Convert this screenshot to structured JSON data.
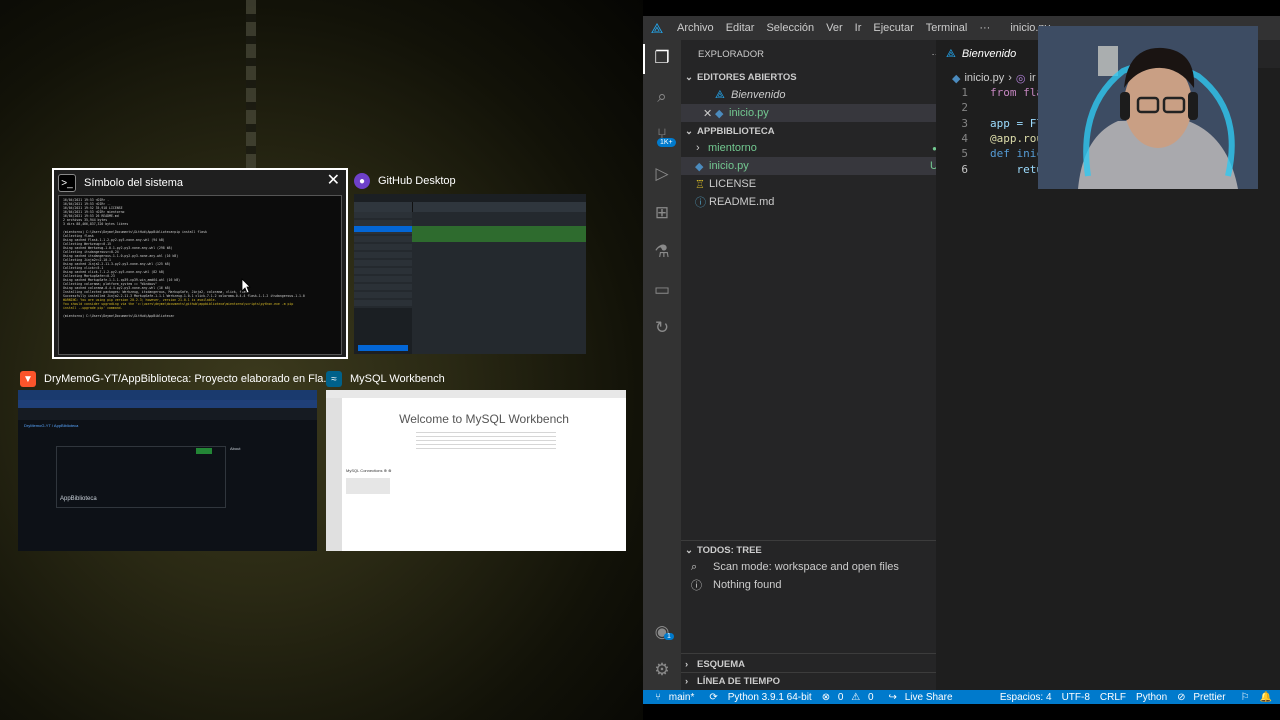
{
  "task_switcher": {
    "windows": [
      {
        "title": "Símbolo del sistema",
        "icon": "terminal-icon",
        "selected": true
      },
      {
        "title": "GitHub Desktop",
        "icon": "github-icon"
      },
      {
        "title": "DryMemoG-YT/AppBiblioteca: Proyecto elaborado en Fla...",
        "icon": "brave-browser-icon"
      },
      {
        "title": "MySQL Workbench",
        "icon": "mysql-workbench-icon"
      }
    ],
    "terminal_lines": [
      "16/04/2021  19:53    <DIR>          .",
      "16/04/2021  19:53    <DIR>          ..",
      "16/04/2021  19:52            35,918 LICENSE",
      "16/04/2021  19:53    <DIR>          mientorno",
      "16/04/2021  19:53                 26 README.md",
      "               2 archivos         35,944 bytes",
      "               3 dirs  88,466,837,320 bytes libres",
      "",
      "(mientorno) C:\\Users\\Deyme\\Documents\\GitHub\\AppBiblioteca>pip install flask",
      "Collecting flask",
      "  Using cached Flask-1.1.2-py2.py3-none-any.whl (94 kB)",
      "Collecting Werkzeug>=0.15",
      "  Using cached Werkzeug-1.0.1-py2.py3-none-any.whl (298 kB)",
      "Collecting itsdangerous>=0.24",
      "  Using cached itsdangerous-1.1.0-py2.py3-none-any.whl (16 kB)",
      "Collecting Jinja2>=2.10.1",
      "  Using cached Jinja2-2.11.3-py2.py3-none-any.whl (125 kB)",
      "Collecting click>=5.1",
      "  Using cached click-7.1.2-py2.py3-none-any.whl (82 kB)",
      "Collecting MarkupSafe>=0.23",
      "  Using cached MarkupSafe-1.1.1-cp39-cp39-win_amd64.whl (16 kB)",
      "Collecting colorama; platform_system == \"Windows\"",
      "  Using cached colorama-0.4.4-py2.py3-none-any.whl (16 kB)",
      "Installing collected packages: Werkzeug, itsdangerous, MarkupSafe, Jinja2, colorama, click, flask",
      "Successfully installed Jinja2-2.11.3 MarkupSafe-1.1.1 Werkzeug-1.0.1 click-7.1.2 colorama-0.4.4 flask-1.1.2 itsdangerous-1.1.0",
      "WARNING: You are using pip version 20.2.3; however, version 21.0.1 is available.",
      "You should consider upgrading via the 'c:\\users\\deyme\\documents\\github\\appbiblioteca\\mientorno\\scripts\\python.exe -m pip",
      " install --upgrade pip' command.",
      "",
      "(mientorno) C:\\Users\\Deyme\\Documents\\GitHub\\AppBiblioteca>"
    ],
    "browser_thumb": {
      "repo": "DryMemoG-YT / AppBiblioteca",
      "about": "About",
      "project": "AppBiblioteca"
    },
    "mysql_thumb": {
      "welcome": "Welcome to MySQL Workbench",
      "connections": "MySQL Connections ⊕ ⊗"
    }
  },
  "vscode": {
    "menu": [
      "Archivo",
      "Editar",
      "Selección",
      "Ver",
      "Ir",
      "Ejecutar",
      "Terminal",
      "···"
    ],
    "window_title": "inicio.py",
    "explorer_title": "EXPLORADOR",
    "open_editors_header": "EDITORES ABIERTOS",
    "open_editors": [
      {
        "name": "Bienvenido",
        "italic": true
      },
      {
        "name": "inicio.py",
        "status": "U"
      }
    ],
    "project_header": "APPBIBLIOTECA",
    "files": [
      {
        "name": "mientorno",
        "type": "folder"
      },
      {
        "name": "inicio.py",
        "type": "python",
        "status": "U"
      },
      {
        "name": "LICENSE",
        "type": "license"
      },
      {
        "name": "README.md",
        "type": "markdown"
      }
    ],
    "todos_header": "TODOS: TREE",
    "todos_items": [
      "Scan mode: workspace and open files",
      "Nothing found"
    ],
    "outline_header": "ESQUEMA",
    "timeline_header": "LÍNEA DE TIEMPO",
    "source_control_badge": "1K+",
    "account_badge": "1",
    "tab_label": "Bienvenido",
    "breadcrumb": {
      "file": "inicio.py",
      "symbol": "ir"
    },
    "code": [
      {
        "num": "1",
        "text": "from fla"
      },
      {
        "num": "2",
        "text": ""
      },
      {
        "num": "3",
        "text": "app = Fl"
      },
      {
        "num": "4",
        "text": "@app.rou"
      },
      {
        "num": "5",
        "text": "def inic"
      },
      {
        "num": "6",
        "text": "    retu"
      }
    ],
    "status": {
      "branch": "main*",
      "python": "Python 3.9.1 64-bit",
      "errors": "0",
      "warnings": "0",
      "live_share": "Live Share",
      "spaces": "Espacios: 4",
      "encoding": "UTF-8",
      "eol": "CRLF",
      "language": "Python",
      "prettier": "Prettier"
    },
    "colors": {
      "accent": "#007acc",
      "untracked": "#73c991"
    }
  }
}
